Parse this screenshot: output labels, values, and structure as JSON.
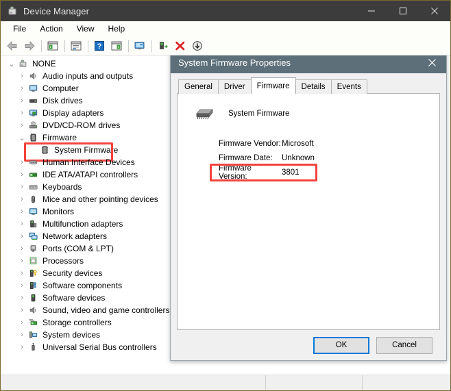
{
  "window": {
    "title": "Device Manager",
    "icon": "device-manager-icon",
    "controls": {
      "minimize": "—",
      "maximize": "□",
      "close": "✕"
    }
  },
  "menubar": {
    "items": [
      {
        "label": "File",
        "name": "menu-file"
      },
      {
        "label": "Action",
        "name": "menu-action"
      },
      {
        "label": "View",
        "name": "menu-view"
      },
      {
        "label": "Help",
        "name": "menu-help"
      }
    ]
  },
  "toolbar": {
    "buttons": [
      {
        "name": "back-button",
        "icon": "back-arrow-icon"
      },
      {
        "name": "forward-button",
        "icon": "forward-arrow-icon"
      },
      {
        "name": "show-hide-console-tree-button",
        "icon": "console-tree-icon"
      },
      {
        "name": "properties-button",
        "icon": "properties-icon"
      },
      {
        "name": "help-button",
        "icon": "help-question-icon"
      },
      {
        "name": "show-hide-action-pane-button",
        "icon": "action-pane-icon"
      },
      {
        "name": "scan-for-hardware-changes-button",
        "icon": "scan-monitor-icon"
      },
      {
        "name": "update-driver-button",
        "icon": "update-driver-icon"
      },
      {
        "name": "uninstall-device-button",
        "icon": "red-x-icon"
      },
      {
        "name": "disable-device-button",
        "icon": "down-arrow-circle-icon"
      }
    ]
  },
  "tree": {
    "nodes": [
      {
        "label": "NONE",
        "depth": 0,
        "state": "expanded",
        "icon": "computer-root-icon",
        "highlighted": false
      },
      {
        "label": "Audio inputs and outputs",
        "depth": 1,
        "state": "collapsed",
        "icon": "speaker-icon",
        "highlighted": false
      },
      {
        "label": "Computer",
        "depth": 1,
        "state": "collapsed",
        "icon": "monitor-icon",
        "highlighted": false
      },
      {
        "label": "Disk drives",
        "depth": 1,
        "state": "collapsed",
        "icon": "disk-drive-icon",
        "highlighted": false
      },
      {
        "label": "Display adapters",
        "depth": 1,
        "state": "collapsed",
        "icon": "display-adapter-icon",
        "highlighted": false
      },
      {
        "label": "DVD/CD-ROM drives",
        "depth": 1,
        "state": "collapsed",
        "icon": "optical-drive-icon",
        "highlighted": false
      },
      {
        "label": "Firmware",
        "depth": 1,
        "state": "expanded",
        "icon": "firmware-chip-icon",
        "highlighted": false
      },
      {
        "label": "System Firmware",
        "depth": 2,
        "state": "leaf",
        "icon": "firmware-chip-icon",
        "highlighted": true
      },
      {
        "label": "Human Interface Devices",
        "depth": 1,
        "state": "collapsed",
        "icon": "hid-icon",
        "highlighted": false
      },
      {
        "label": "IDE ATA/ATAPI controllers",
        "depth": 1,
        "state": "collapsed",
        "icon": "ide-controller-icon",
        "highlighted": false
      },
      {
        "label": "Keyboards",
        "depth": 1,
        "state": "collapsed",
        "icon": "keyboard-icon",
        "highlighted": false
      },
      {
        "label": "Mice and other pointing devices",
        "depth": 1,
        "state": "collapsed",
        "icon": "mouse-icon",
        "highlighted": false
      },
      {
        "label": "Monitors",
        "depth": 1,
        "state": "collapsed",
        "icon": "monitor-icon",
        "highlighted": false
      },
      {
        "label": "Multifunction adapters",
        "depth": 1,
        "state": "collapsed",
        "icon": "multifunction-adapter-icon",
        "highlighted": false
      },
      {
        "label": "Network adapters",
        "depth": 1,
        "state": "collapsed",
        "icon": "network-adapter-icon",
        "highlighted": false
      },
      {
        "label": "Ports (COM & LPT)",
        "depth": 1,
        "state": "collapsed",
        "icon": "port-icon",
        "highlighted": false
      },
      {
        "label": "Processors",
        "depth": 1,
        "state": "collapsed",
        "icon": "processor-icon",
        "highlighted": false
      },
      {
        "label": "Security devices",
        "depth": 1,
        "state": "collapsed",
        "icon": "security-device-icon",
        "highlighted": false
      },
      {
        "label": "Software components",
        "depth": 1,
        "state": "collapsed",
        "icon": "software-component-icon",
        "highlighted": false
      },
      {
        "label": "Software devices",
        "depth": 1,
        "state": "collapsed",
        "icon": "software-device-icon",
        "highlighted": false
      },
      {
        "label": "Sound, video and game controllers",
        "depth": 1,
        "state": "collapsed",
        "icon": "speaker-icon",
        "highlighted": false
      },
      {
        "label": "Storage controllers",
        "depth": 1,
        "state": "collapsed",
        "icon": "storage-controller-icon",
        "highlighted": false
      },
      {
        "label": "System devices",
        "depth": 1,
        "state": "collapsed",
        "icon": "system-device-icon",
        "highlighted": false
      },
      {
        "label": "Universal Serial Bus controllers",
        "depth": 1,
        "state": "collapsed",
        "icon": "usb-controller-icon",
        "highlighted": false
      }
    ],
    "chevron_expanded": "⌄",
    "chevron_collapsed": "›"
  },
  "dialog": {
    "title": "System Firmware Properties",
    "close_label": "✕",
    "tabs": [
      {
        "label": "General",
        "name": "tab-general",
        "active": false
      },
      {
        "label": "Driver",
        "name": "tab-driver",
        "active": false
      },
      {
        "label": "Firmware",
        "name": "tab-firmware",
        "active": true
      },
      {
        "label": "Details",
        "name": "tab-details",
        "active": false
      },
      {
        "label": "Events",
        "name": "tab-events",
        "active": false
      }
    ],
    "device_name": "System Firmware",
    "device_icon": "firmware-chip-icon",
    "fields": [
      {
        "key": "Firmware Vendor:",
        "value": "Microsoft",
        "highlighted": false
      },
      {
        "key": "Firmware Date:",
        "value": "Unknown",
        "highlighted": false
      },
      {
        "key": "Firmware Version:",
        "value": "3801",
        "highlighted": true
      }
    ],
    "buttons": {
      "ok": "OK",
      "cancel": "Cancel"
    }
  },
  "statusbar": {
    "pane1": "",
    "pane2": "",
    "pane3": ""
  },
  "colors": {
    "titlebar": "#3c3c3c",
    "dialog_titlebar": "#5d7079",
    "highlight_red": "#f4423c",
    "focus_blue": "#0078d7"
  }
}
